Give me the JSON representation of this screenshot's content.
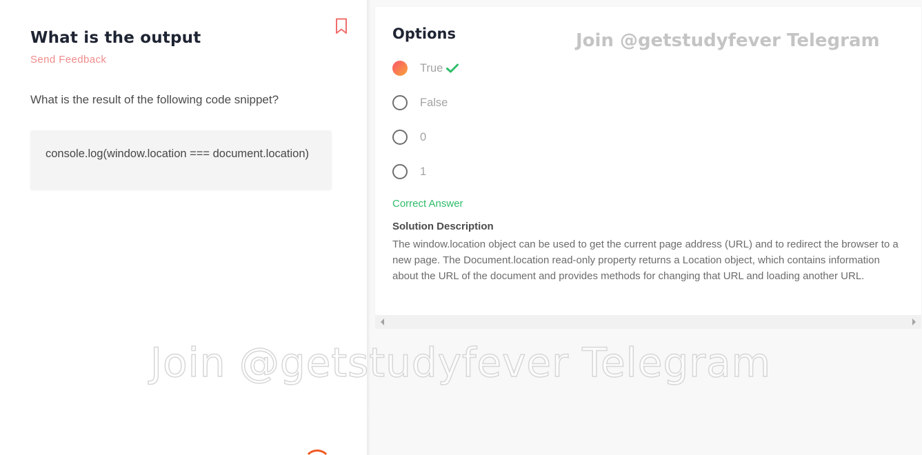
{
  "question": {
    "title": "What is the output",
    "feedback_link": "Send Feedback",
    "prompt": "What is the result of the following code snippet?",
    "code": "console.log(window.location === document.location)",
    "bookmark_icon": "bookmark-icon"
  },
  "options": {
    "title": "Options",
    "items": [
      {
        "label": "True",
        "selected": true,
        "correct": true
      },
      {
        "label": "False",
        "selected": false
      },
      {
        "label": "0",
        "selected": false
      },
      {
        "label": "1",
        "selected": false
      }
    ],
    "correct_label": "Correct Answer",
    "solution_title": "Solution Description",
    "solution_text": "The window.location object can be used to get the current page address (URL) and to redirect the browser to a new page. The Document.location read-only property returns a Location object, which contains information about the URL of the document and provides methods for changing that URL and loading another URL."
  },
  "watermark": {
    "text": "Join @getstudyfever Telegram"
  },
  "colors": {
    "accent": "#f9536b",
    "accent_end": "#f9a53a",
    "correct": "#2ebc69",
    "feedback": "#f08a8a",
    "bookmark": "#f06c6c"
  }
}
